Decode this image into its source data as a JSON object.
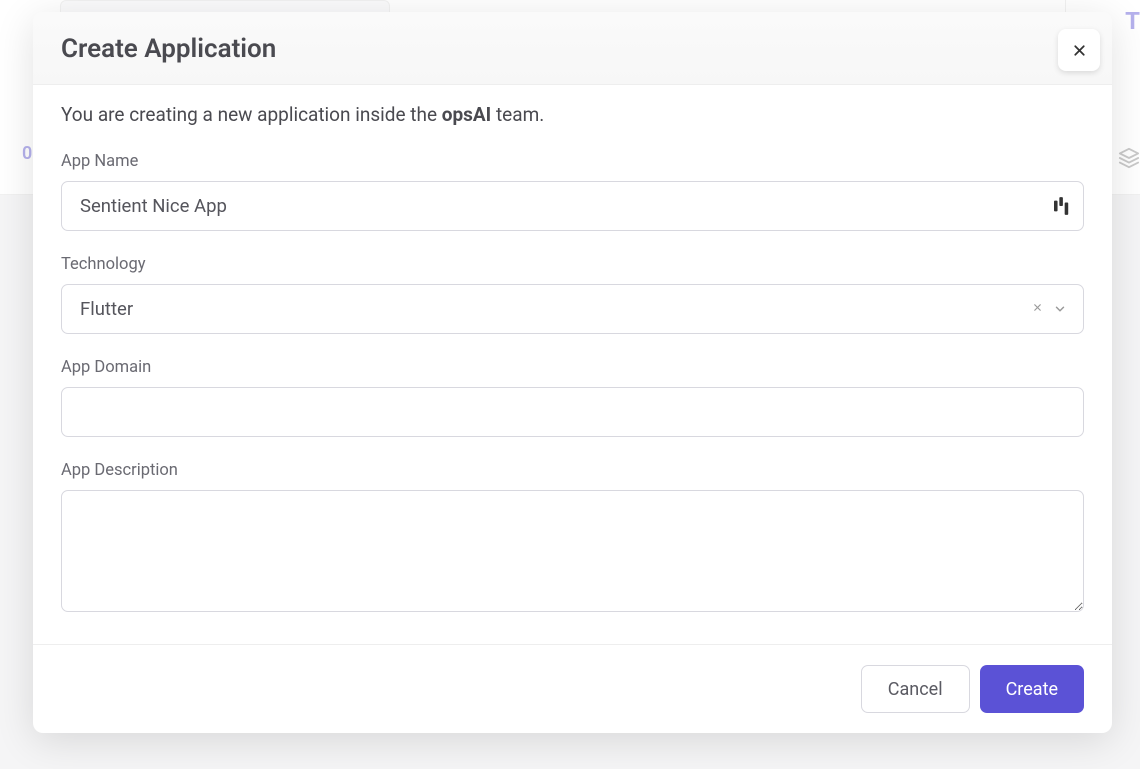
{
  "bg": {
    "count": "0",
    "right_letter": "T"
  },
  "modal": {
    "title": "Create Application",
    "intro_prefix": "You are creating a new application inside the ",
    "team_name": "opsAI",
    "intro_suffix": " team.",
    "fields": {
      "app_name": {
        "label": "App Name",
        "value": "Sentient Nice App"
      },
      "technology": {
        "label": "Technology",
        "value": "Flutter"
      },
      "app_domain": {
        "label": "App Domain",
        "value": ""
      },
      "app_description": {
        "label": "App Description",
        "value": ""
      }
    },
    "buttons": {
      "cancel": "Cancel",
      "create": "Create"
    }
  }
}
